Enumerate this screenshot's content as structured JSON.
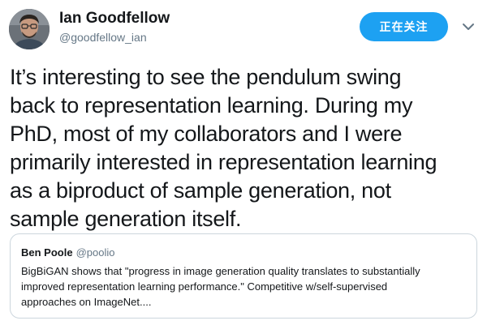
{
  "tweet": {
    "author": {
      "name": "Ian Goodfellow",
      "handle": "@goodfellow_ian"
    },
    "follow_button_label": "正在关注",
    "text": "It’s interesting to see the pendulum swing\nback to representation learning. During my\nPhD, most of my collaborators and I were\nprimarily interested in representation learning\nas a biproduct of sample generation, not\nsample generation itself.",
    "icons": {
      "more": "chevron-down-icon",
      "avatar": "avatar"
    }
  },
  "quote": {
    "author_name": "Ben Poole",
    "author_handle": "@poolio",
    "text": "BigBiGAN shows that \"progress in image generation quality translates to substantially\nimproved representation learning performance.\" Competitive w/self-supervised\napproaches on ImageNet...."
  },
  "colors": {
    "accent": "#1da1f2",
    "text_primary": "#14171a",
    "text_secondary": "#657786",
    "border": "#ccd6dd"
  }
}
